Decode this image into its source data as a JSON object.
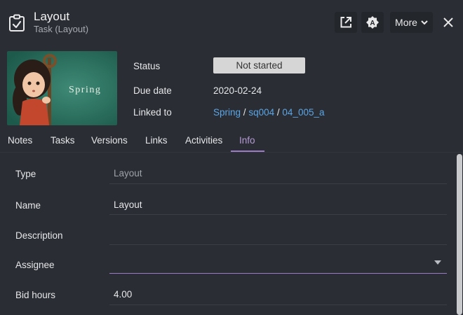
{
  "header": {
    "title": "Layout",
    "subtitle": "Task (Layout)",
    "more_label": "More",
    "icons": [
      "task-clipboard-icon",
      "open-external-icon",
      "asset-icon",
      "chevron-down-icon",
      "close-icon"
    ]
  },
  "thumbnail": {
    "caption": "Spring"
  },
  "info": {
    "status_label": "Status",
    "status_value": "Not started",
    "due_label": "Due date",
    "due_value": "2020-02-24",
    "linked_label": "Linked to",
    "links": [
      "Spring",
      "sq004",
      "04_005_a"
    ],
    "separator": "/"
  },
  "tabs": [
    {
      "label": "Notes"
    },
    {
      "label": "Tasks"
    },
    {
      "label": "Versions"
    },
    {
      "label": "Links"
    },
    {
      "label": "Activities"
    },
    {
      "label": "Info",
      "active": true
    }
  ],
  "form": {
    "type_label": "Type",
    "type_value": "Layout",
    "name_label": "Name",
    "name_value": "Layout",
    "description_label": "Description",
    "description_value": "",
    "assignee_label": "Assignee",
    "assignee_value": "",
    "bid_label": "Bid hours",
    "bid_value": "4.00"
  },
  "colors": {
    "background": "#2a2d33",
    "accent": "#9a7bc4",
    "link": "#5aa6e6",
    "status_badge": "#d6d6d6"
  }
}
